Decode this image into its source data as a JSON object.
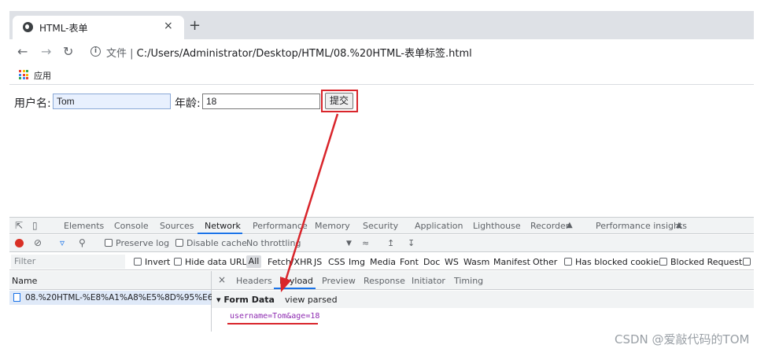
{
  "browser": {
    "tab_title": "HTML-表单",
    "tab_close": "×",
    "new_tab": "+",
    "url_prefix": "文件 |",
    "url": "C:/Users/Administrator/Desktop/HTML/08.%20HTML-表单标签.html",
    "bookmark_apps": "应用"
  },
  "page": {
    "username_label": "用户名:",
    "username_value": "Tom",
    "age_label": "年龄:",
    "age_value": "18",
    "submit_label": "提交"
  },
  "devtools": {
    "tabs": [
      "Elements",
      "Console",
      "Sources",
      "Network",
      "Performance",
      "Memory",
      "Security",
      "Application",
      "Lighthouse",
      "Recorder",
      "Performance insights"
    ],
    "active_tab": "Network",
    "preserve_log": "Preserve log",
    "disable_cache": "Disable cache",
    "throttling": "No throttling",
    "filter_placeholder": "Filter",
    "invert": "Invert",
    "hide_data_urls": "Hide data URLs",
    "type_filters": [
      "All",
      "Fetch/XHR",
      "JS",
      "CSS",
      "Img",
      "Media",
      "Font",
      "Doc",
      "WS",
      "Wasm",
      "Manifest",
      "Other"
    ],
    "blocked_cookies": "Has blocked cookies",
    "blocked_requests": "Blocked Requests",
    "name_column": "Name",
    "request_name": "08.%20HTML-%E8%A1%A8%E5%8D%95%E6%...",
    "detail_close": "×",
    "detail_tabs": [
      "Headers",
      "Payload",
      "Preview",
      "Response",
      "Initiator",
      "Timing"
    ],
    "active_detail_tab": "Payload",
    "form_data_title": "▾ Form Data",
    "view_parsed": "view parsed",
    "form_data_value": "username=Tom&age=18"
  },
  "watermark": "CSDN @爱敲代码的TOM",
  "colors": {
    "highlight": "#d9252b",
    "devtools_accent": "#1a73e8",
    "record": "#d93025"
  }
}
